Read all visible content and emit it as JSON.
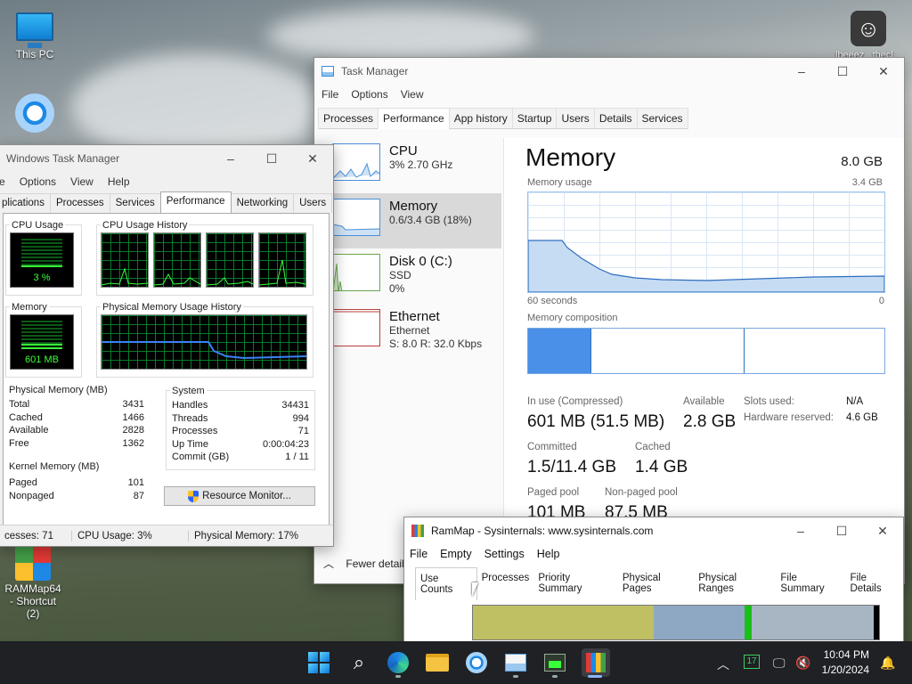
{
  "desktop": {
    "icons": [
      {
        "label": "This PC"
      },
      {
        "label": ""
      },
      {
        "label": "RAMMap64 - Shortcut (2)"
      }
    ],
    "user_name": "lbeeez...thecl"
  },
  "old_tm": {
    "title": "Windows Task Manager",
    "menu": [
      "e",
      "Options",
      "View",
      "Help"
    ],
    "tabs": [
      "plications",
      "Processes",
      "Services",
      "Performance",
      "Networking",
      "Users"
    ],
    "cpu_usage_label": "CPU Usage",
    "cpu_usage_value": "3 %",
    "cpu_usage_fraction": 0.03,
    "cpu_history_label": "CPU Usage History",
    "memory_label": "Memory",
    "memory_value": "601 MB",
    "memory_fraction": 0.17,
    "pmh_label": "Physical Memory Usage History",
    "physical_memory": {
      "title": "Physical Memory (MB)",
      "rows": [
        {
          "k": "Total",
          "v": "3431"
        },
        {
          "k": "Cached",
          "v": "1466"
        },
        {
          "k": "Available",
          "v": "2828"
        },
        {
          "k": "Free",
          "v": "1362"
        }
      ]
    },
    "kernel_memory": {
      "title": "Kernel Memory (MB)",
      "rows": [
        {
          "k": "Paged",
          "v": "101"
        },
        {
          "k": "Nonpaged",
          "v": "87"
        }
      ]
    },
    "system": {
      "title": "System",
      "rows": [
        {
          "k": "Handles",
          "v": "34431"
        },
        {
          "k": "Threads",
          "v": "994"
        },
        {
          "k": "Processes",
          "v": "71"
        },
        {
          "k": "Up Time",
          "v": "0:00:04:23"
        },
        {
          "k": "Commit (GB)",
          "v": "1 / 11"
        }
      ]
    },
    "resource_button": "Resource Monitor...",
    "status": [
      "cesses: 71",
      "CPU Usage: 3%",
      "Physical Memory: 17%"
    ]
  },
  "new_tm": {
    "title": "Task Manager",
    "menu": [
      "File",
      "Options",
      "View"
    ],
    "tabs": [
      "Processes",
      "Performance",
      "App history",
      "Startup",
      "Users",
      "Details",
      "Services"
    ],
    "items": [
      {
        "name": "CPU",
        "line1": "3% 2.70 GHz",
        "line2": ""
      },
      {
        "name": "Memory",
        "line1": "0.6/3.4 GB (18%)",
        "line2": ""
      },
      {
        "name": "Disk 0 (C:)",
        "line1": "SSD",
        "line2": "0%"
      },
      {
        "name": "Ethernet",
        "line1": "Ethernet",
        "line2": "S: 8.0  R: 32.0 Kbps"
      }
    ],
    "memory": {
      "title": "Memory",
      "total": "8.0 GB",
      "usage_label": "Memory usage",
      "usage_max": "3.4 GB",
      "time_left": "60 seconds",
      "time_right": "0",
      "composition_label": "Memory composition",
      "in_use_label": "In use (Compressed)",
      "in_use_value": "601 MB (51.5 MB)",
      "available_label": "Available",
      "available_value": "2.8 GB",
      "slots_label": "Slots used:",
      "slots_value": "N/A",
      "hw_reserved_label": "Hardware reserved:",
      "hw_reserved_value": "4.6 GB",
      "committed_label": "Committed",
      "committed_value": "1.5/11.4 GB",
      "cached_label": "Cached",
      "cached_value": "1.4 GB",
      "paged_label": "Paged pool",
      "paged_value": "101 MB",
      "nonpaged_label": "Non-paged pool",
      "nonpaged_value": "87.5 MB"
    },
    "fewer_details": "Fewer details"
  },
  "rammap": {
    "title": "RamMap - Sysinternals: www.sysinternals.com",
    "menu": [
      "File",
      "Empty",
      "Settings",
      "Help"
    ],
    "tabs": [
      "Use Counts",
      "Processes",
      "Priority Summary",
      "Physical Pages",
      "Physical Ranges",
      "File Summary",
      "File Details"
    ]
  },
  "taskbar": {
    "time": "10:04 PM",
    "date": "1/20/2024",
    "tray_badge": "17"
  }
}
